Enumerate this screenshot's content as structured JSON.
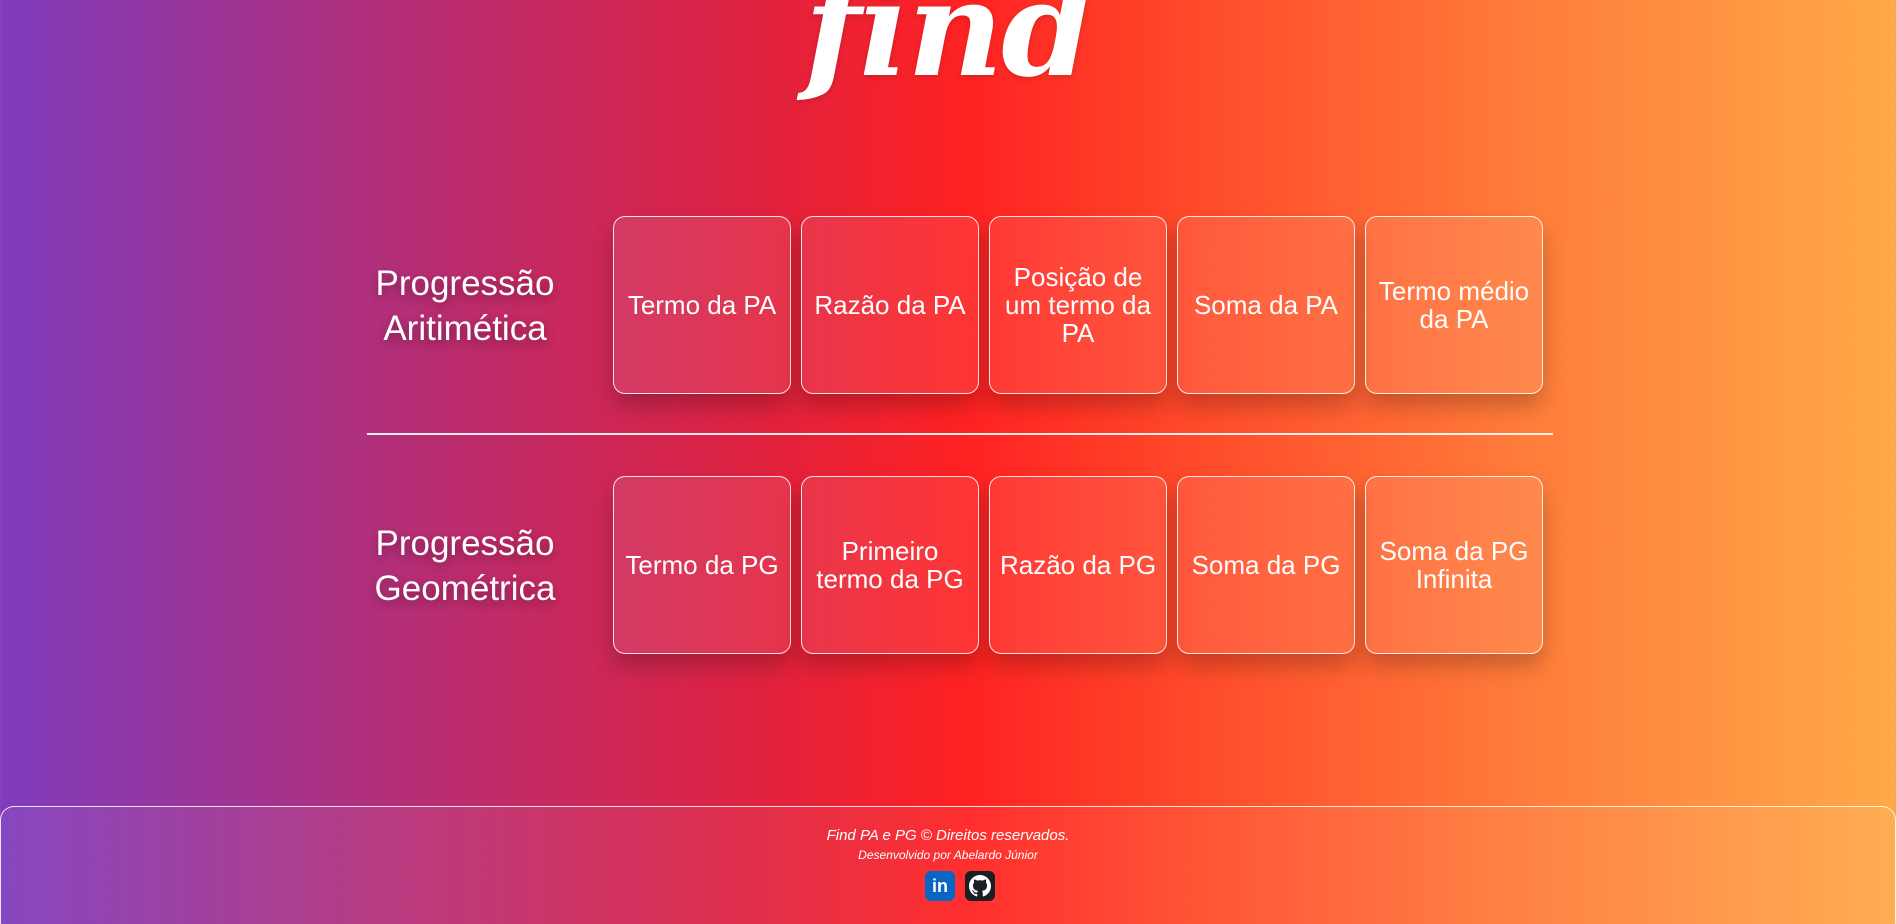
{
  "logo": {
    "text": "find"
  },
  "arithmetic": {
    "title": "Progressão Aritimética",
    "cards": [
      {
        "label": "Termo da PA"
      },
      {
        "label": "Razão da PA"
      },
      {
        "label": "Posição de um termo da PA"
      },
      {
        "label": "Soma da PA"
      },
      {
        "label": "Termo médio da PA"
      }
    ]
  },
  "geometric": {
    "title": "Progressão Geométrica",
    "cards": [
      {
        "label": "Termo da PG"
      },
      {
        "label": "Primeiro termo da PG"
      },
      {
        "label": "Razão da PG"
      },
      {
        "label": "Soma da PG"
      },
      {
        "label": "Soma da PG Infinita"
      }
    ]
  },
  "footer": {
    "copyright": "Find PA e PG © Direitos reservados.",
    "developer": "Desenvolvido por Abelardo Júnior",
    "social": [
      {
        "icon": "linkedin-icon",
        "text": "in",
        "color": "#0a66c2"
      },
      {
        "icon": "github-icon",
        "color": "#1b1f23"
      }
    ]
  }
}
